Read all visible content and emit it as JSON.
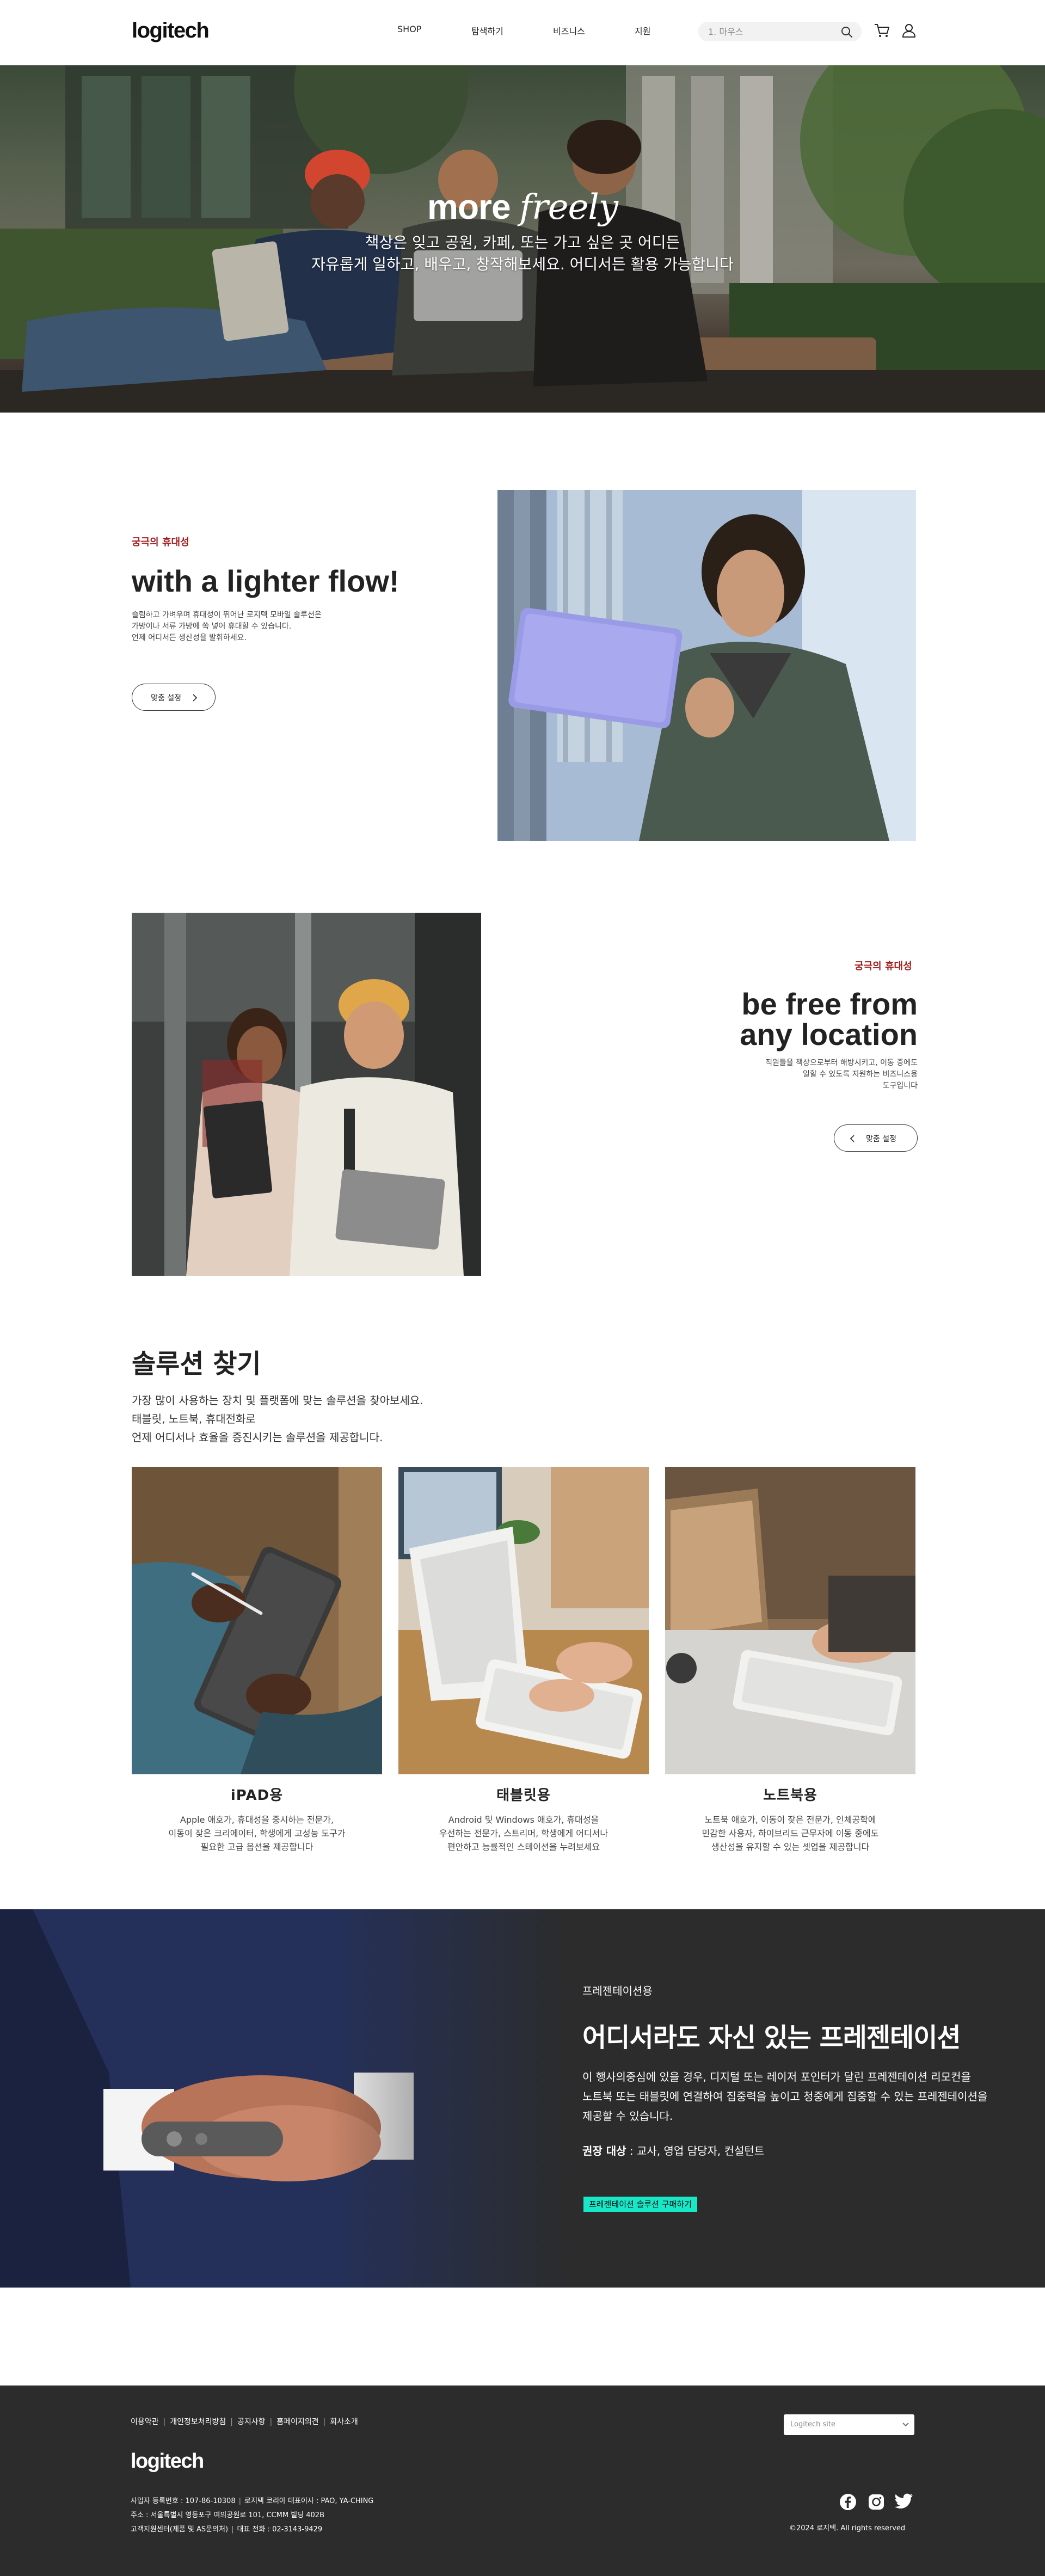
{
  "header": {
    "logo": "logitech",
    "nav": [
      "SHOP",
      "탐색하기",
      "비즈니스",
      "지원"
    ],
    "search_placeholder": "1. 마우스"
  },
  "hero": {
    "title_bold": "more",
    "title_script": "freely",
    "subtitle_line1": "책상은 잊고 공원, 카페, 또는 가고 싶은 곳 어디든",
    "subtitle_line2": "자유롭게 일하고, 배우고, 창작해보세요. 어디서든 활용 가능합니다"
  },
  "feature1": {
    "eyebrow": "궁극의 휴대성",
    "title": "with a lighter flow!",
    "body_lines": [
      "슬림하고 가벼우며 휴대성이 뛰어난 로지텍 모바일 솔루션은",
      "가방이나 서류 가방에 쏙 넣어 휴대할 수 있습니다.",
      "언제 어디서든 생산성을 발휘하세요."
    ],
    "button": "맞춤 설정"
  },
  "feature2": {
    "eyebrow": "궁극의 휴대성",
    "title_line1": "be free from",
    "title_line2": "any location",
    "body_lines": [
      "직원들을 책상으로부터 해방시키고, 이동 중에도",
      "일할 수 있도록 지원하는 비즈니스용",
      "도구입니다"
    ],
    "button": "맞춤 설정"
  },
  "solutions": {
    "title": "솔루션 찾기",
    "desc_lines": [
      "가장 많이 사용하는 장치 및 플랫폼에 맞는 솔루션을 찾아보세요.",
      "태블릿, 노트북, 휴대전화로",
      "언제 어디서나 효율을 증진시키는 솔루션을 제공합니다."
    ],
    "cards": [
      {
        "title": "iPAD용",
        "desc": [
          "Apple 애호가, 휴대성을 중시하는 전문가,",
          "이동이 잦은 크리에이터, 학생에게 고성능 도구가",
          "필요한 고급 옵션을 제공합니다"
        ]
      },
      {
        "title": "태블릿용",
        "desc": [
          "Android 및 Windows 애호가, 휴대성을",
          "우선하는 전문가, 스트리머, 학생에게 어디서나",
          "편안하고 능률적인 스테이션을 누려보세요"
        ]
      },
      {
        "title": "노트북용",
        "desc": [
          "노트북 애호가, 이동이 잦은 전문가, 인체공학에",
          "민감한 사용자, 하이브리드 근무자에 이동 중에도",
          "생산성을 유지할 수 있는 셋업을 제공합니다"
        ]
      }
    ]
  },
  "presentation": {
    "eyebrow": "프레젠테이션용",
    "title": "어디서라도 자신 있는 프레젠테이션",
    "body_lines": [
      "이 행사의중심에 있을 경우, 디지털 또는 레이저 포인터가 달린 프레젠테이션 리모컨을",
      "노트북 또는 태블릿에 연결하여 집중력을 높이고 청중에게 집중할 수 있는 프레젠테이션을",
      "제공할 수 있습니다."
    ],
    "reco_label": "권장 대상",
    "reco_value": " : 교사, 영업 담당자, 컨설턴트",
    "cta": "프레젠테이션 솔루션 구매하기"
  },
  "footer": {
    "links": [
      "이용약관",
      "개인정보처리방침",
      "공지사항",
      "홈페이지의견",
      "회사소개"
    ],
    "site_select": "Logitech site",
    "logo": "logitech",
    "info_line1_a": "사업자 등록번호 : 107-86-10308",
    "info_line1_b": "로지텍 코리아 대표이사 : PAO, YA-CHING",
    "info_line2": "주소 : 서울특별시 영등포구 여의공원로 101, CCMM 빌딩 402B",
    "info_line3_a": "고객지원센터(제품 및 AS문의처)",
    "info_line3_b": "대표 전화 : 02-3143-9429",
    "copyright": "©2024 로지텍. All rights reserved",
    "social_icons": [
      "facebook-icon",
      "instagram-icon",
      "twitter-icon"
    ]
  },
  "colors": {
    "accent_red": "#a31f1f",
    "cta_teal": "#17e8c8",
    "dark_band": "#2c2c2c"
  }
}
